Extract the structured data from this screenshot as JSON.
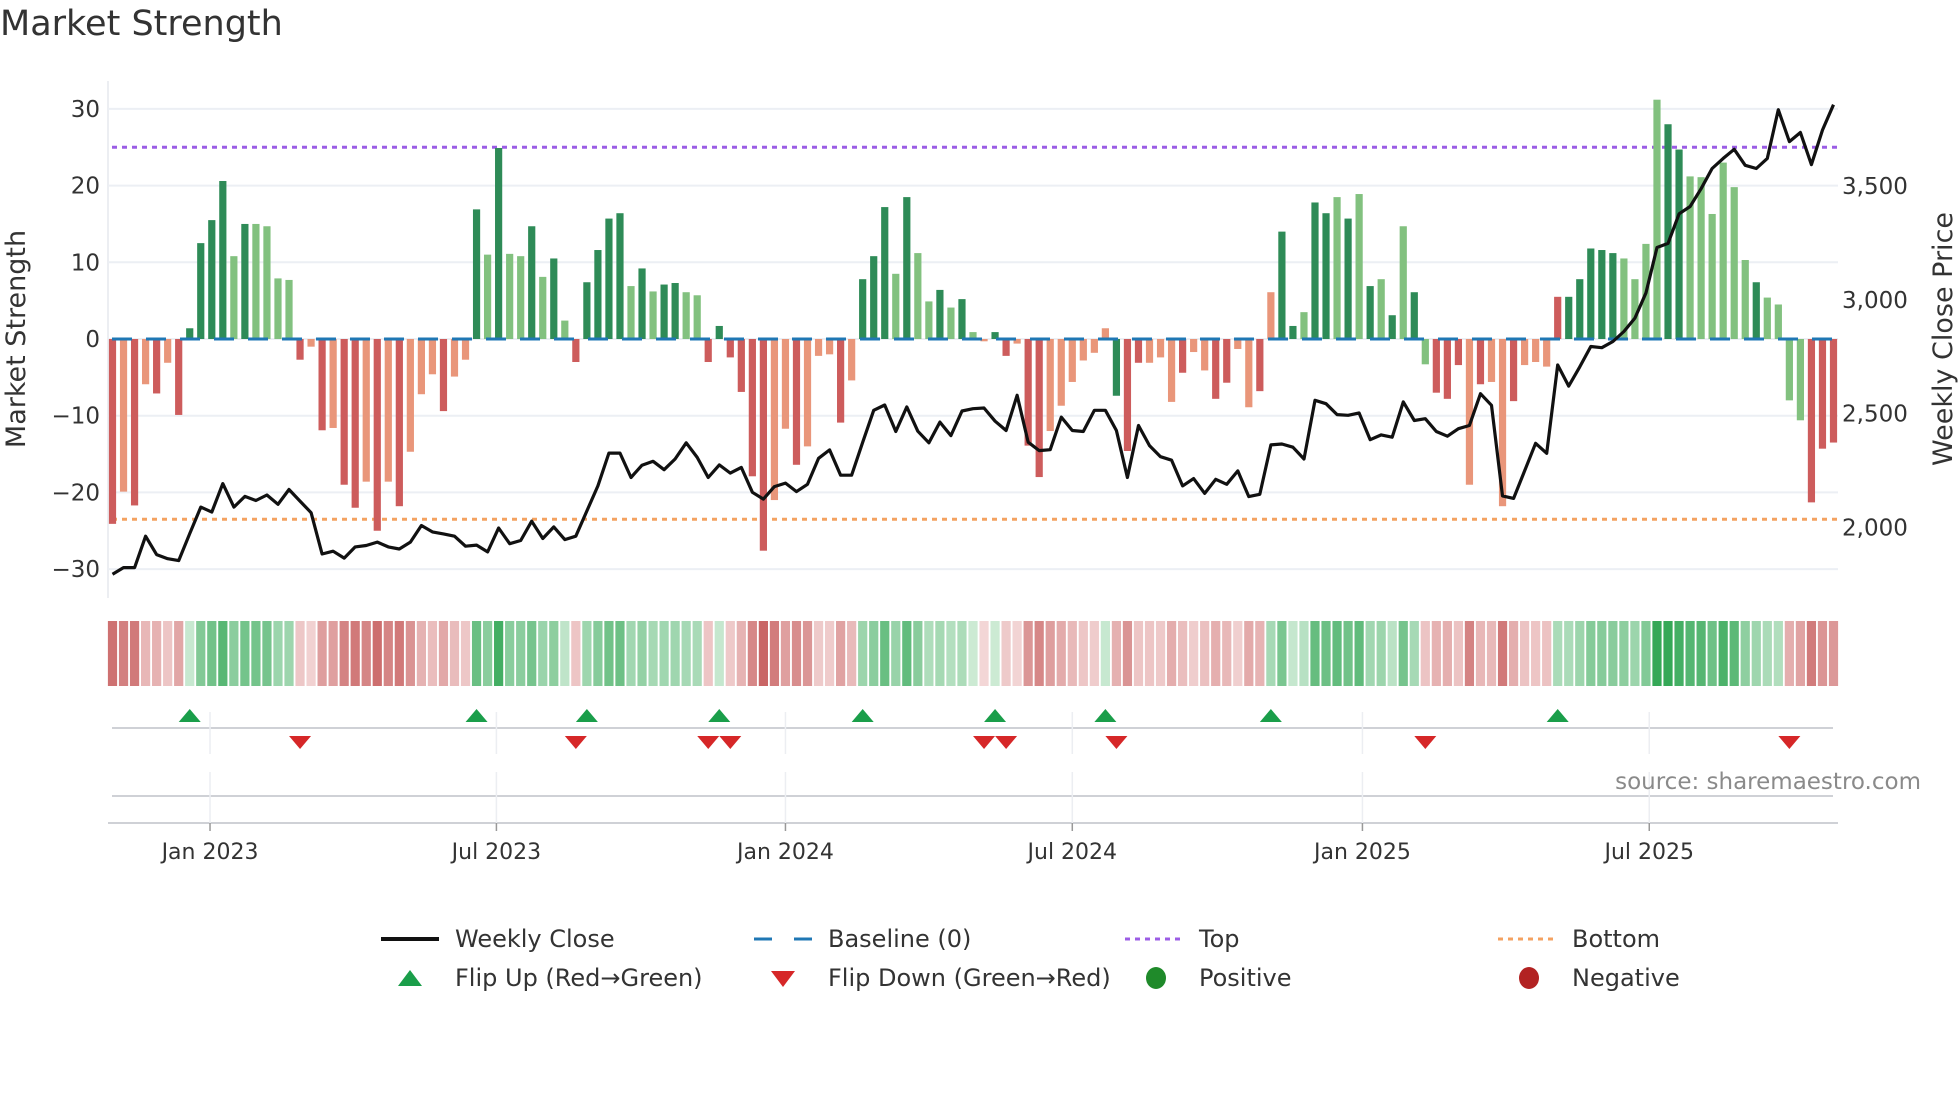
{
  "title": "Market Strength",
  "source": "source: sharemaestro.com",
  "colors": {
    "strong_green": "#2e8b57",
    "light_green": "#82c17f",
    "red": "#cd5c5c",
    "salmon": "#e9967a",
    "line": "#111111",
    "baseline": "#1f77b4",
    "top": "#9b5de5",
    "bottom": "#f4a261",
    "flip_up": "#1a9e4a",
    "flip_down": "#d62728",
    "positive": "#1f8a2a",
    "negative": "#b22222"
  },
  "legend": {
    "weekly_close": "Weekly Close",
    "baseline": "Baseline (0)",
    "top": "Top",
    "bottom": "Bottom",
    "flip_up": "Flip Up (Red→Green)",
    "flip_down": "Flip Down (Green→Red)",
    "positive": "Positive",
    "negative": "Negative"
  },
  "chart_data": {
    "type": "bar",
    "title": "Market Strength",
    "ylabel": "Market Strength",
    "y2label": "Weekly Close Price",
    "ylim": [
      -33.8,
      33.6
    ],
    "y2lim": [
      1690,
      3961
    ],
    "yticks": [
      "30",
      "20",
      "10",
      "0",
      "−10",
      "−20",
      "−30"
    ],
    "ytick_values": [
      30,
      20,
      10,
      0,
      -10,
      -20,
      -30
    ],
    "y2ticks": [
      "2,000",
      "2,500",
      "3,000",
      "3,500"
    ],
    "y2tick_values": [
      2000,
      2500,
      3000,
      3500
    ],
    "xticks": [
      {
        "label": "Jan 2023",
        "week": 8.84
      },
      {
        "label": "Jul 2023",
        "week": 34.8
      },
      {
        "label": "Jan 2024",
        "week": 61.0
      },
      {
        "label": "Jul 2024",
        "week": 87.0
      },
      {
        "label": "Jan 2025",
        "week": 113.3
      },
      {
        "label": "Jul 2025",
        "week": 139.3
      }
    ],
    "top_level": 25,
    "bottom_level": -23.5,
    "baseline": 0,
    "strength": [
      -24.1,
      -19.9,
      -21.7,
      -5.9,
      -7.1,
      -3.1,
      -9.9,
      1.4,
      12.5,
      15.5,
      20.6,
      10.8,
      15.0,
      15.0,
      14.7,
      7.9,
      7.7,
      -2.7,
      -1.0,
      -11.9,
      -11.6,
      -19.0,
      -22.0,
      -18.6,
      -25.0,
      -18.6,
      -21.8,
      -14.7,
      -7.2,
      -4.6,
      -9.4,
      -4.9,
      -2.7,
      16.9,
      11.0,
      24.9,
      11.1,
      10.8,
      14.7,
      8.1,
      10.5,
      2.4,
      -3.0,
      7.4,
      11.6,
      15.7,
      16.4,
      6.9,
      9.2,
      6.2,
      7.1,
      7.3,
      6.1,
      5.7,
      -3.0,
      1.7,
      -2.4,
      -6.9,
      -17.9,
      -27.6,
      -21.0,
      -11.7,
      -16.4,
      -14.0,
      -2.2,
      -2.0,
      -10.9,
      -5.4,
      7.8,
      10.8,
      17.2,
      8.5,
      18.5,
      11.2,
      4.9,
      6.4,
      4.1,
      5.2,
      0.9,
      -0.3,
      0.9,
      -2.2,
      -0.6,
      -13.9,
      -18.0,
      -12.0,
      -8.7,
      -5.6,
      -2.8,
      -1.8,
      1.4,
      -7.4,
      -14.6,
      -3.1,
      -3.1,
      -2.4,
      -8.2,
      -4.4,
      -1.7,
      -4.1,
      -7.8,
      -5.7,
      -1.3,
      -8.9,
      -6.8,
      6.1,
      14.0,
      1.7,
      3.5,
      17.8,
      16.4,
      18.5,
      15.7,
      18.9,
      6.9,
      7.8,
      3.1,
      14.7,
      6.1,
      -3.3,
      -7.0,
      -7.8,
      -3.4,
      -19.0,
      -5.9,
      -5.6,
      -21.8,
      -8.1,
      -3.4,
      -3.0,
      -3.6,
      5.5,
      5.5,
      7.8,
      11.8,
      11.6,
      11.2,
      10.5,
      7.8,
      12.4,
      31.2,
      28.0,
      24.7,
      21.2,
      21.1,
      16.3,
      23.0,
      19.8,
      10.3,
      7.4,
      5.4,
      4.5,
      -8.0,
      -10.6,
      -21.3,
      -14.3,
      -13.5
    ],
    "shade": "rsrsrsrddddldllllrsrsrrsrsrsssrssdldlldldlrddddldlddllrdrrrrssrsssrsdddldlldldlsdrsrrssssssdrrsssrssrrssrsddlddldldldldlrrrsrssrsssrdddddllllddlllllldllllrrrss",
    "weekly_close": [
      1795,
      1824,
      1824,
      1962,
      1881,
      1863,
      1855,
      1973,
      2090,
      2068,
      2193,
      2090,
      2137,
      2119,
      2143,
      2102,
      2167,
      2116,
      2065,
      1884,
      1896,
      1866,
      1915,
      1921,
      1936,
      1915,
      1906,
      1936,
      2009,
      1981,
      1972,
      1962,
      1918,
      1923,
      1893,
      1998,
      1929,
      1943,
      2028,
      1952,
      2003,
      1947,
      1962,
      2073,
      2183,
      2327,
      2327,
      2220,
      2274,
      2291,
      2254,
      2301,
      2372,
      2308,
      2220,
      2275,
      2239,
      2264,
      2155,
      2125,
      2180,
      2195,
      2158,
      2190,
      2304,
      2341,
      2230,
      2230,
      2375,
      2515,
      2538,
      2422,
      2530,
      2423,
      2372,
      2463,
      2404,
      2512,
      2522,
      2525,
      2467,
      2426,
      2581,
      2375,
      2338,
      2342,
      2485,
      2426,
      2422,
      2515,
      2515,
      2426,
      2220,
      2448,
      2360,
      2311,
      2296,
      2183,
      2215,
      2150,
      2212,
      2190,
      2249,
      2136,
      2146,
      2363,
      2367,
      2353,
      2301,
      2559,
      2544,
      2496,
      2493,
      2503,
      2386,
      2407,
      2397,
      2552,
      2470,
      2478,
      2422,
      2401,
      2434,
      2448,
      2588,
      2537,
      2139,
      2128,
      2249,
      2370,
      2326,
      2714,
      2621,
      2706,
      2795,
      2790,
      2817,
      2861,
      2920,
      3031,
      3230,
      3248,
      3378,
      3410,
      3488,
      3577,
      3621,
      3661,
      3591,
      3577,
      3621,
      3835,
      3695,
      3735,
      3594,
      3746,
      3857
    ],
    "flip_up_weeks": [
      7,
      33,
      43,
      55,
      68,
      80,
      90,
      105,
      131
    ],
    "flip_down_weeks": [
      17,
      42,
      54,
      56,
      79,
      81,
      91,
      119,
      152
    ],
    "legend_position": "bottom"
  }
}
